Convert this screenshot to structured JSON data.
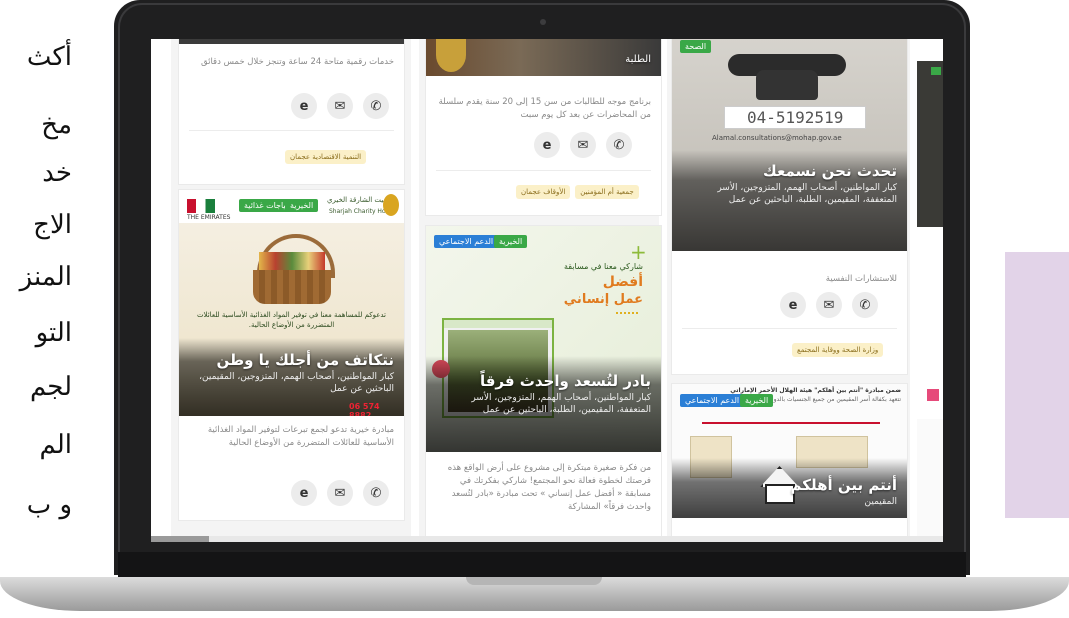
{
  "side_text": {
    "lines": [
      "أكث",
      "مخ",
      "خد",
      "الاج",
      "المنز",
      "التو",
      "لجم",
      "الم",
      "و ب"
    ]
  },
  "colors": {
    "green_tag": "#3aa847",
    "blue_tag": "#2b7fd6",
    "chip_bg": "#fbf0c8",
    "bezel": "#1f1f20",
    "side_panel": "#e2d3e8"
  },
  "screen": {
    "col1": {
      "card1": {
        "desc": "خدمات رقمية متاحة 24 ساعة وتنجز خلال خمس دقائق",
        "chip": "التنمية الاقتصادية عجمان"
      },
      "card2": {
        "tags": [
          "الخيرية",
          "احتياجات غذائية"
        ],
        "logo_text": "بيت الشارقة الخيري",
        "logo_sub": "Sharjah Charity House",
        "emirates": "THE EMIRATES",
        "poster_line": "تدعوكم للمساهمة معنا في توفير المواد الغذائية الأساسية للعائلات المتضررة من الأوضاع الحالية.",
        "title": "نتكاتف من أجلك يا وطن",
        "sub": "كبار المواطنين، أصحاب الهمم، المتزوجين، المقيمين، الباحثين عن عمل",
        "phone_small": "06 574 8882",
        "desc": "مبادرة خيرية تدعو لجمع تبرعات لتوفير المواد الغذائية الأساسية للعائلات المتضررة من الأوضاع الحالية"
      }
    },
    "col2": {
      "card1": {
        "top_title": "الطلبة",
        "desc": "برنامج موجه للطالبات من سن 15 إلى 20 سنة يقدم سلسلة من المحاضرات عن بعد كل يوم سبت",
        "chips": [
          "جمعية أم المؤمنين",
          "الأوقاف عجمان"
        ]
      },
      "card2": {
        "tags": [
          "الخيرية",
          "الدعم الاجتماعي"
        ],
        "poster_a": "شاركي معنا في مسابقة",
        "poster_b": "أفضل",
        "poster_c": "عمل إنساني",
        "title": "بادر لتُسعد واحدث فرقاً",
        "sub": "كبار المواطنين، أصحاب الهمم، المتزوجين، الأسر المتعففة، المقيمين، الطلبة، الباحثين عن عمل",
        "desc": "من فكرة صغيرة مبتكرة إلى مشروع على أرض الواقع هذه فرصتك لخطوة فعالة نحو المجتمع! شاركي بفكرتك في مسابقة « أفضل عمل إنساني » تحت مبادرة «بادر لتُسعد واحدث فرقاً» المشاركة"
      }
    },
    "col3": {
      "card1": {
        "tags": [
          "الصحة"
        ],
        "phone": "04-5192519",
        "email": "Alamal.consultations@mohap.gov.ae",
        "title": "تحدث نحن نسمعك",
        "sub": "كبار المواطنين، أصحاب الهمم، المتزوجين، الأسر المتعففة، المقيمين، الطلبة، الباحثين عن عمل",
        "desc": "للاستشارات النفسية",
        "chip": "وزارة الصحة ووقاية المجتمع"
      },
      "card2": {
        "tags": [
          "الخيرية",
          "الدعم الاجتماعي"
        ],
        "head": "ضمن مبادرة \"أنتم بين أهلكم\" هيئة الهلال الأحمر الإماراتي",
        "head2": "تتعهد بكفالة أسر المقيمين من جميع الجنسيات بالدولة",
        "title": "أنتم بين أهلكم",
        "sub": "المقيمين"
      }
    },
    "icons": [
      "explorer-icon",
      "mail-icon",
      "phone-icon"
    ]
  }
}
